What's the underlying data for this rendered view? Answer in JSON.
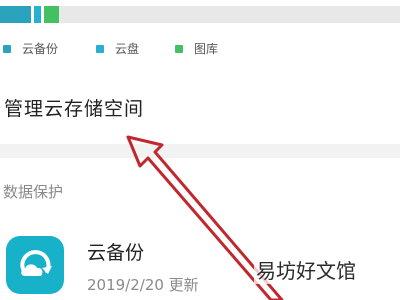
{
  "storage": {
    "legend": [
      {
        "label": "云备份",
        "color": "#2aa3bc"
      },
      {
        "label": "云盘",
        "color": "#26b1cf"
      },
      {
        "label": "图库",
        "color": "#43c062"
      }
    ]
  },
  "manage": {
    "label": "管理云存储空间"
  },
  "section": {
    "title": "数据保护"
  },
  "app": {
    "name": "云备份",
    "date": "2019/2/20 更新",
    "icon": "cloud-backup-icon"
  },
  "annotation": {
    "color": "#c0282e"
  },
  "watermark": {
    "text": "易坊好文馆"
  }
}
